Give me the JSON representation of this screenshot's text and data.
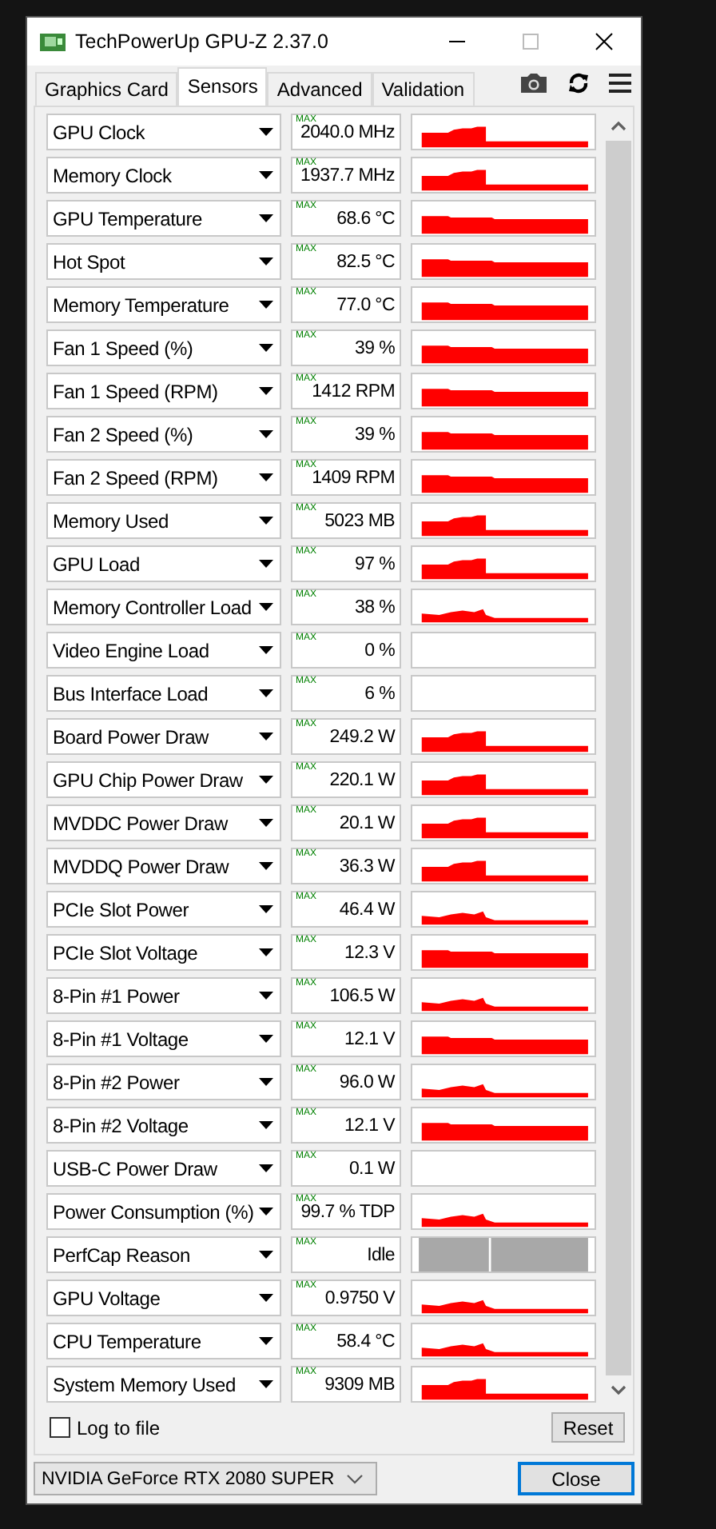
{
  "window": {
    "title": "TechPowerUp GPU-Z 2.37.0"
  },
  "tabs": [
    {
      "label": "Graphics Card",
      "selected": false
    },
    {
      "label": "Sensors",
      "selected": true
    },
    {
      "label": "Advanced",
      "selected": false
    },
    {
      "label": "Validation",
      "selected": false
    }
  ],
  "sensors": [
    {
      "name": "GPU Clock",
      "max_label": "MAX",
      "value": "2040.0 MHz",
      "kind": "spike"
    },
    {
      "name": "Memory Clock",
      "max_label": "MAX",
      "value": "1937.7 MHz",
      "kind": "spike"
    },
    {
      "name": "GPU Temperature",
      "max_label": "MAX",
      "value": "68.6 °C",
      "kind": "full"
    },
    {
      "name": "Hot Spot",
      "max_label": "MAX",
      "value": "82.5 °C",
      "kind": "full"
    },
    {
      "name": "Memory Temperature",
      "max_label": "MAX",
      "value": "77.0 °C",
      "kind": "full"
    },
    {
      "name": "Fan 1 Speed (%)",
      "max_label": "MAX",
      "value": "39 %",
      "kind": "full"
    },
    {
      "name": "Fan 1 Speed (RPM)",
      "max_label": "MAX",
      "value": "1412 RPM",
      "kind": "full"
    },
    {
      "name": "Fan 2 Speed (%)",
      "max_label": "MAX",
      "value": "39 %",
      "kind": "full"
    },
    {
      "name": "Fan 2 Speed (RPM)",
      "max_label": "MAX",
      "value": "1409 RPM",
      "kind": "full"
    },
    {
      "name": "Memory Used",
      "max_label": "MAX",
      "value": "5023 MB",
      "kind": "spike"
    },
    {
      "name": "GPU Load",
      "max_label": "MAX",
      "value": "97 %",
      "kind": "spike"
    },
    {
      "name": "Memory Controller Load",
      "max_label": "MAX",
      "value": "38 %",
      "kind": "low"
    },
    {
      "name": "Video Engine Load",
      "max_label": "MAX",
      "value": "0 %",
      "kind": "empty"
    },
    {
      "name": "Bus Interface Load",
      "max_label": "MAX",
      "value": "6 %",
      "kind": "empty"
    },
    {
      "name": "Board Power Draw",
      "max_label": "MAX",
      "value": "249.2 W",
      "kind": "spike"
    },
    {
      "name": "GPU Chip Power Draw",
      "max_label": "MAX",
      "value": "220.1 W",
      "kind": "spike"
    },
    {
      "name": "MVDDC Power Draw",
      "max_label": "MAX",
      "value": "20.1 W",
      "kind": "spike"
    },
    {
      "name": "MVDDQ Power Draw",
      "max_label": "MAX",
      "value": "36.3 W",
      "kind": "spike"
    },
    {
      "name": "PCIe Slot Power",
      "max_label": "MAX",
      "value": "46.4 W",
      "kind": "low"
    },
    {
      "name": "PCIe Slot Voltage",
      "max_label": "MAX",
      "value": "12.3 V",
      "kind": "full"
    },
    {
      "name": "8-Pin #1 Power",
      "max_label": "MAX",
      "value": "106.5 W",
      "kind": "low"
    },
    {
      "name": "8-Pin #1 Voltage",
      "max_label": "MAX",
      "value": "12.1 V",
      "kind": "full"
    },
    {
      "name": "8-Pin #2 Power",
      "max_label": "MAX",
      "value": "96.0 W",
      "kind": "low"
    },
    {
      "name": "8-Pin #2 Voltage",
      "max_label": "MAX",
      "value": "12.1 V",
      "kind": "full"
    },
    {
      "name": "USB-C Power Draw",
      "max_label": "MAX",
      "value": "0.1 W",
      "kind": "empty"
    },
    {
      "name": "Power Consumption (%)",
      "max_label": "MAX",
      "value": "99.7 % TDP",
      "kind": "low"
    },
    {
      "name": "PerfCap Reason",
      "max_label": "MAX",
      "value": "Idle",
      "kind": "perfcap"
    },
    {
      "name": "GPU Voltage",
      "max_label": "MAX",
      "value": "0.9750 V",
      "kind": "low"
    },
    {
      "name": "CPU Temperature",
      "max_label": "MAX",
      "value": "58.4 °C",
      "kind": "low"
    },
    {
      "name": "System Memory Used",
      "max_label": "MAX",
      "value": "9309 MB",
      "kind": "spike"
    }
  ],
  "log_to_file": {
    "label": "Log to file",
    "checked": false
  },
  "reset": "Reset",
  "device": "NVIDIA GeForce RTX 2080 SUPER",
  "close": "Close"
}
